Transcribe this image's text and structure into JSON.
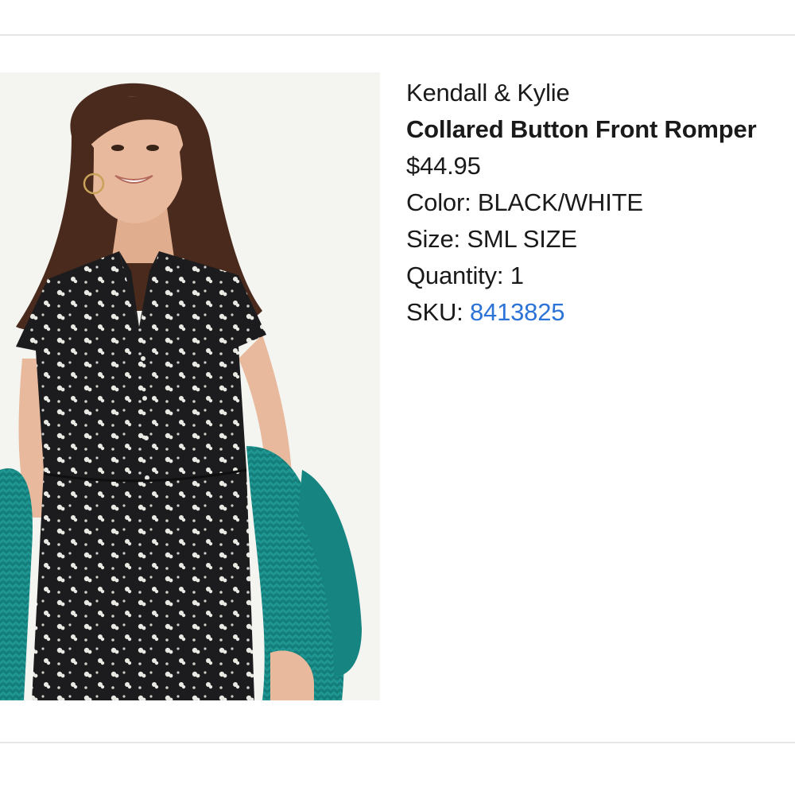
{
  "product": {
    "brand": "Kendall & Kylie",
    "name": "Collared Button Front Romper",
    "price": "$44.95",
    "color_label": "Color:",
    "color_value": "BLACK/WHITE",
    "size_label": "Size:",
    "size_value": "SML SIZE",
    "quantity_label": "Quantity:",
    "quantity_value": "1",
    "sku_label": "SKU:",
    "sku_value": "8413825",
    "image_alt_icon": "product-photo-icon"
  },
  "colors": {
    "text": "#1a1a1a",
    "link": "#2b73d6",
    "divider": "#e6e6e6",
    "romper": "#1c1c1e",
    "cardigan": "#1a8a86",
    "hair": "#4a2a1c",
    "skin": "#e8b99c"
  }
}
